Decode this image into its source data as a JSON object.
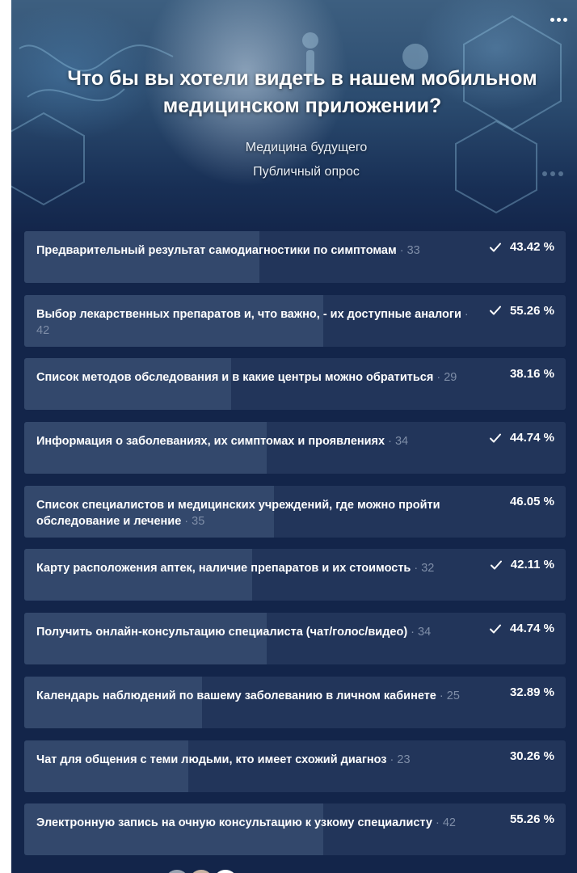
{
  "poll": {
    "title": "Что бы вы хотели видеть в нашем мобильном медицинском приложении?",
    "author": "Медицина будущего",
    "type": "Публичный опрос",
    "menu_icon": "more-dots-icon"
  },
  "colors": {
    "card_bg": "#13254a",
    "option_bg": "#22355a",
    "option_fill": "#33486c",
    "text": "#ffffff",
    "count_text": "#7f8ea8"
  },
  "options": [
    {
      "text": "Предварительный результат самодиагностики по симптомам",
      "count_label": " · 33",
      "percent_label": "43.42 %",
      "percent": 43.42,
      "voted": true
    },
    {
      "text": "Выбор лекарственных препаратов и, что важно, - их доступные аналоги",
      "count_label": " · 42",
      "percent_label": "55.26 %",
      "percent": 55.26,
      "voted": true
    },
    {
      "text": "Список методов обследования и в какие центры можно обратиться",
      "count_label": " · 29",
      "percent_label": "38.16 %",
      "percent": 38.16,
      "voted": false
    },
    {
      "text": "Информация о заболеваниях, их симптомах и проявлениях",
      "count_label": " · 34",
      "percent_label": "44.74 %",
      "percent": 44.74,
      "voted": true
    },
    {
      "text": "Список специалистов и медицинских учреждений, где можно пройти обследование и лечение",
      "count_label": " · 35",
      "percent_label": "46.05 %",
      "percent": 46.05,
      "voted": false
    },
    {
      "text": "Карту расположения аптек, наличие препаратов и их стоимость",
      "count_label": " · 32",
      "percent_label": "42.11 %",
      "percent": 42.11,
      "voted": true
    },
    {
      "text": "Получить онлайн-консультацию специалиста (чат/голос/видео)",
      "count_label": " · 34",
      "percent_label": "44.74 %",
      "percent": 44.74,
      "voted": true
    },
    {
      "text": "Календарь наблюдений по вашему заболеванию в личном кабинете",
      "count_label": " · 25",
      "percent_label": "32.89 %",
      "percent": 32.89,
      "voted": false
    },
    {
      "text": "Чат для общения с теми людьми, кто имеет схожий диагноз",
      "count_label": " · 23",
      "percent_label": "30.26 %",
      "percent": 30.26,
      "voted": false
    },
    {
      "text": "Электронную запись на очную консультацию к узкому специалисту",
      "count_label": " · 42",
      "percent_label": "55.26 %",
      "percent": 55.26,
      "voted": false
    }
  ],
  "voters": {
    "icon": "voter-avatar-icon",
    "avatar_colors": [
      "#9aa3b1",
      "#c9b4a4",
      "#ffffff"
    ]
  }
}
